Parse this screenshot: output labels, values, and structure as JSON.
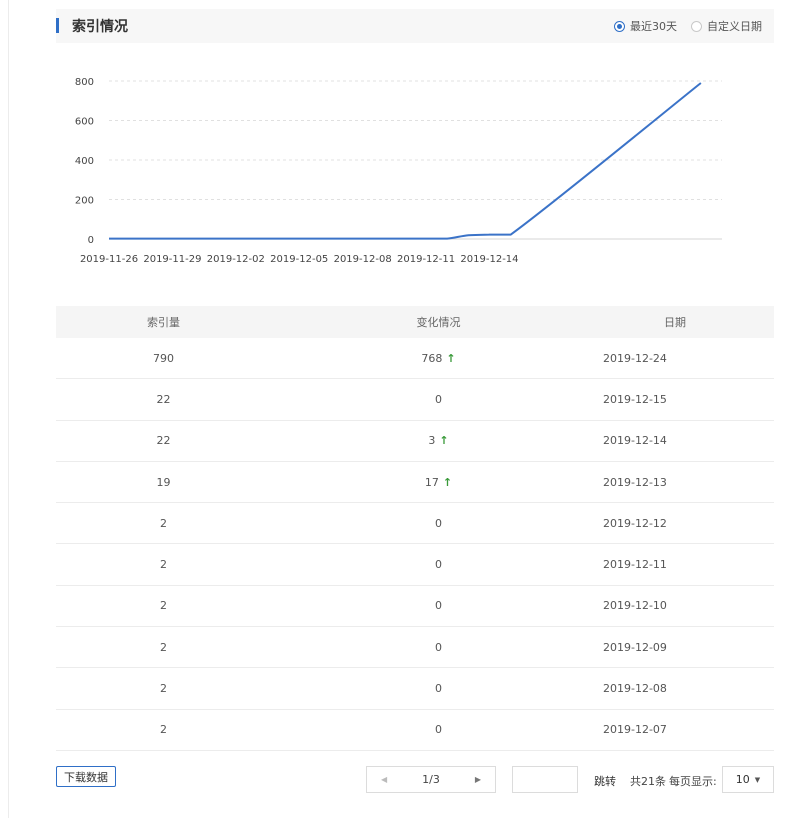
{
  "header": {
    "title": "索引情况",
    "radio_recent": "最近30天",
    "radio_custom": "自定义日期"
  },
  "chart_data": {
    "type": "line",
    "x": [
      "2019-11-26",
      "2019-11-27",
      "2019-11-28",
      "2019-11-29",
      "2019-11-30",
      "2019-12-01",
      "2019-12-02",
      "2019-12-03",
      "2019-12-04",
      "2019-12-05",
      "2019-12-06",
      "2019-12-07",
      "2019-12-08",
      "2019-12-09",
      "2019-12-10",
      "2019-12-11",
      "2019-12-12",
      "2019-12-13",
      "2019-12-14",
      "2019-12-15",
      "2019-12-24"
    ],
    "x_tick_labels": [
      "2019-11-26",
      "2019-11-29",
      "2019-12-02",
      "2019-12-05",
      "2019-12-08",
      "2019-12-11",
      "2019-12-14"
    ],
    "series": [
      {
        "values": [
          2,
          2,
          2,
          2,
          2,
          2,
          2,
          2,
          2,
          2,
          2,
          2,
          2,
          2,
          2,
          2,
          2,
          19,
          22,
          22,
          790
        ],
        "color": "#3b73c8"
      }
    ],
    "yticks": [
      0,
      200,
      400,
      600,
      800
    ],
    "ylim": [
      0,
      800
    ],
    "grid": true
  },
  "table": {
    "headers": [
      "索引量",
      "变化情况",
      "日期"
    ],
    "rows": [
      {
        "count": "790",
        "change": "768",
        "up": true,
        "date": "2019-12-24"
      },
      {
        "count": "22",
        "change": "0",
        "up": false,
        "date": "2019-12-15"
      },
      {
        "count": "22",
        "change": "3",
        "up": true,
        "date": "2019-12-14"
      },
      {
        "count": "19",
        "change": "17",
        "up": true,
        "date": "2019-12-13"
      },
      {
        "count": "2",
        "change": "0",
        "up": false,
        "date": "2019-12-12"
      },
      {
        "count": "2",
        "change": "0",
        "up": false,
        "date": "2019-12-11"
      },
      {
        "count": "2",
        "change": "0",
        "up": false,
        "date": "2019-12-10"
      },
      {
        "count": "2",
        "change": "0",
        "up": false,
        "date": "2019-12-09"
      },
      {
        "count": "2",
        "change": "0",
        "up": false,
        "date": "2019-12-08"
      },
      {
        "count": "2",
        "change": "0",
        "up": false,
        "date": "2019-12-07"
      }
    ]
  },
  "footer": {
    "download": "下载数据",
    "page": "1/3",
    "jump": "跳转",
    "total": "共21条",
    "per_page_label": "每页显示:",
    "per_page_value": "10"
  },
  "colors": {
    "accent": "#2f6fc7",
    "line": "#3b73c8",
    "up_arrow": "#3a9a3a"
  }
}
